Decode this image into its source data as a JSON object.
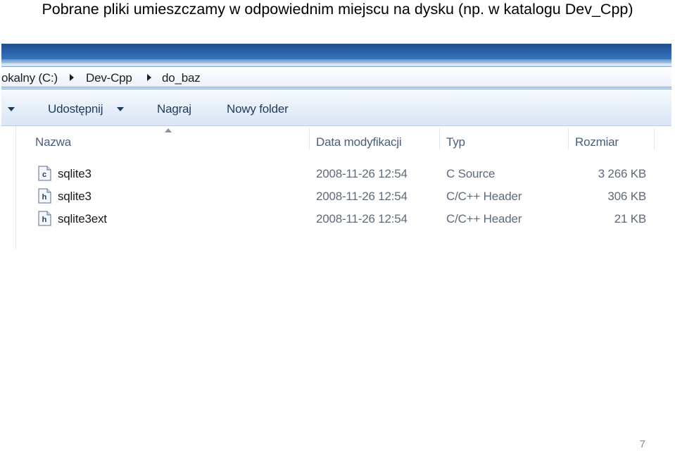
{
  "slide": {
    "title": "Pobrane pliki umieszczamy w odpowiednim miejscu na dysku (np. w katalogu Dev_Cpp)",
    "page_number": "7"
  },
  "explorer": {
    "breadcrumb": [
      "okalny (C:)",
      "Dev-Cpp",
      "do_baz"
    ],
    "toolbar": {
      "share_label": "Udostępnij",
      "burn_label": "Nagraj",
      "new_folder_label": "Nowy folder"
    },
    "columns": {
      "name": "Nazwa",
      "date": "Data modyfikacji",
      "type": "Typ",
      "size": "Rozmiar"
    },
    "files": [
      {
        "name": "sqlite3",
        "date": "2008-11-26 12:54",
        "type": "C Source",
        "size": "3 266 KB",
        "icon": "c-source-file-icon",
        "letter": "c"
      },
      {
        "name": "sqlite3",
        "date": "2008-11-26 12:54",
        "type": "C/C++ Header",
        "size": "306 KB",
        "icon": "header-file-icon",
        "letter": "h"
      },
      {
        "name": "sqlite3ext",
        "date": "2008-11-26 12:54",
        "type": "C/C++ Header",
        "size": "21 KB",
        "icon": "header-file-icon",
        "letter": "h"
      }
    ],
    "colors": {
      "frame": "#2d68b0",
      "header_text": "#4a5e7a",
      "detail_text": "#5c6b7d"
    }
  }
}
